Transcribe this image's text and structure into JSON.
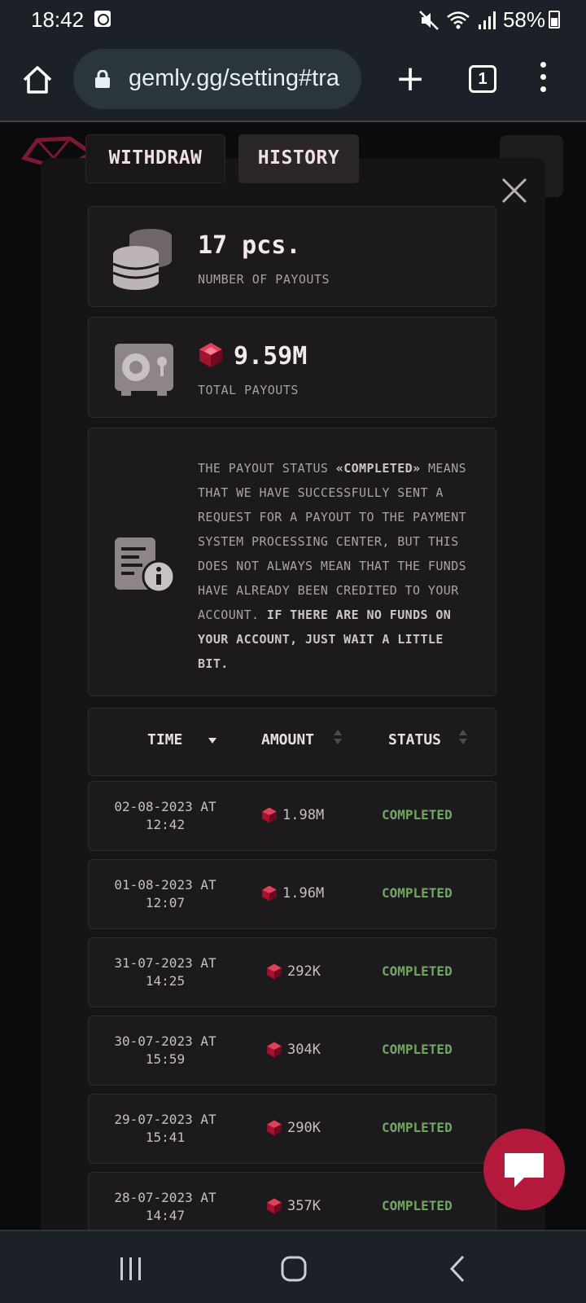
{
  "status_bar": {
    "time": "18:42",
    "battery": "58%"
  },
  "browser": {
    "url": "gemly.gg/setting#tra",
    "tab_count": "1"
  },
  "tabs": {
    "withdraw": "WITHDRAW",
    "history": "HISTORY"
  },
  "stats": {
    "payout_count": "17 pcs.",
    "payout_count_label": "NUMBER OF PAYOUTS",
    "total": "9.59M",
    "total_label": "TOTAL PAYOUTS"
  },
  "info": {
    "part1": "THE PAYOUT STATUS ",
    "status_word": "«COMPLETED»",
    "part2": " MEANS THAT WE HAVE SUCCESSFULLY SENT A REQUEST FOR A PAYOUT TO THE PAYMENT SYSTEM PROCESSING CENTER, BUT THIS DOES NOT ALWAYS MEAN THAT THE FUNDS HAVE ALREADY BEEN CREDITED TO YOUR ACCOUNT. ",
    "emphasis": "IF THERE ARE NO FUNDS ON YOUR ACCOUNT, JUST WAIT A LITTLE BIT."
  },
  "table": {
    "headers": {
      "time": "TIME",
      "amount": "AMOUNT",
      "status": "STATUS"
    },
    "rows": [
      {
        "date": "02-08-2023 AT",
        "time": "12:42",
        "amount": "1.98M",
        "status": "COMPLETED"
      },
      {
        "date": "01-08-2023 AT",
        "time": "12:07",
        "amount": "1.96M",
        "status": "COMPLETED"
      },
      {
        "date": "31-07-2023 AT",
        "time": "14:25",
        "amount": "292K",
        "status": "COMPLETED"
      },
      {
        "date": "30-07-2023 AT",
        "time": "15:59",
        "amount": "304K",
        "status": "COMPLETED"
      },
      {
        "date": "29-07-2023 AT",
        "time": "15:41",
        "amount": "290K",
        "status": "COMPLETED"
      },
      {
        "date": "28-07-2023 AT",
        "time": "14:47",
        "amount": "357K",
        "status": "COMPLETED"
      }
    ]
  },
  "colors": {
    "accent": "#b31a3c",
    "completed": "#6fa85e"
  }
}
